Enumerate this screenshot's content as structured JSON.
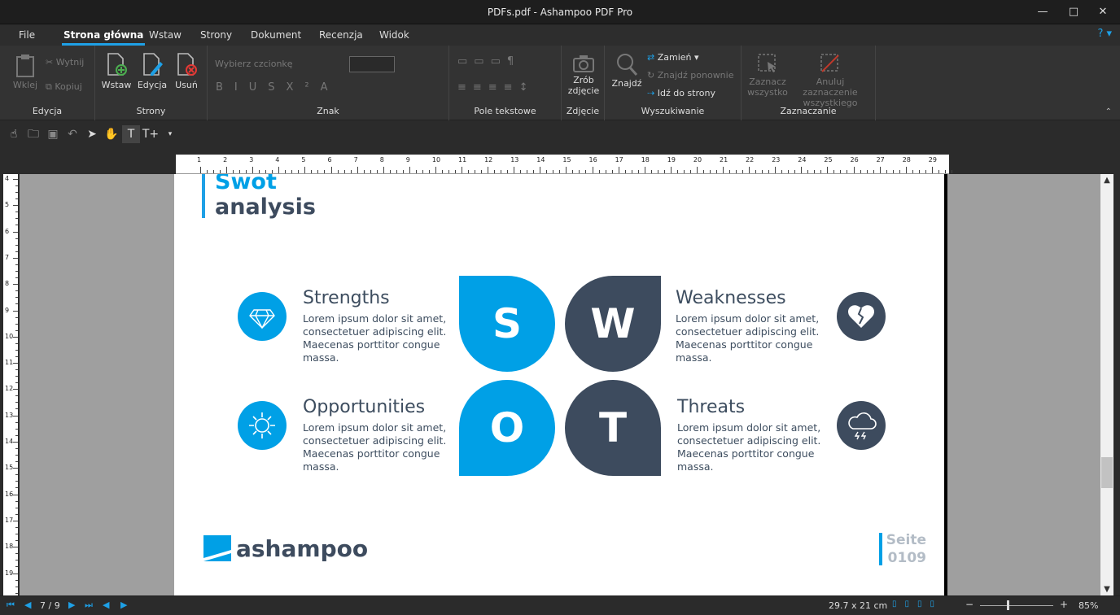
{
  "window": {
    "title": "PDFs.pdf - Ashampoo PDF Pro",
    "minimize": "—",
    "maximize": "□",
    "close": "✕"
  },
  "menu": [
    "File",
    "Strona główna",
    "Wstaw",
    "Strony",
    "Dokument",
    "Recenzja",
    "Widok"
  ],
  "help": "? ▾",
  "ribbon": {
    "edycja": {
      "label": "Edycja",
      "wklej": "Wklej",
      "wytnij": "Wytnij",
      "kopiuj": "Kopiuj"
    },
    "strony": {
      "label": "Strony",
      "wstaw": "Wstaw",
      "edycja": "Edycja",
      "usun": "Usuń"
    },
    "znak": {
      "label": "Znak",
      "font_placeholder": "Wybierz czcionkę"
    },
    "pole": {
      "label": "Pole tekstowe"
    },
    "zdjecie": {
      "label": "Zdjęcie",
      "btn1": "Zrób",
      "btn2": "zdjęcie"
    },
    "wyszukiwanie": {
      "label": "Wyszukiwanie",
      "znajdz": "Znajdź",
      "zamien": "Zamień",
      "znajdz_ponownie": "Znajdź ponownie",
      "idz": "Idź do strony"
    },
    "zaznaczanie": {
      "label": "Zaznaczanie",
      "zaz1": "Zaznacz",
      "zaz2": "wszystko",
      "anul1": "Anuluj zaznaczenie",
      "anul2": "wszystkiego"
    }
  },
  "ruler": {
    "h": [
      "1",
      "2",
      "3",
      "4",
      "5",
      "6",
      "7",
      "8",
      "9",
      "10",
      "11",
      "12",
      "13",
      "14",
      "15",
      "16",
      "17",
      "18",
      "19",
      "20",
      "21",
      "22",
      "23",
      "24",
      "25",
      "26",
      "27",
      "28",
      "29"
    ],
    "v": [
      "4",
      "5",
      "6",
      "7",
      "8",
      "9",
      "10",
      "11",
      "12",
      "13",
      "14",
      "15",
      "16",
      "17",
      "18",
      "19"
    ]
  },
  "doc": {
    "title1": "Swot",
    "title2": "analysis",
    "strengths": {
      "title": "Strengths",
      "text": "Lorem ipsum dolor sit amet, consectetuer adipiscing elit. Maecenas porttitor congue massa."
    },
    "weaknesses": {
      "title": "Weaknesses",
      "text": "Lorem ipsum dolor sit amet, consectetuer adipiscing elit. Maecenas porttitor congue massa."
    },
    "opportunities": {
      "title": "Opportunities",
      "text": "Lorem ipsum dolor sit amet, consectetuer adipiscing elit. Maecenas porttitor congue massa."
    },
    "threats": {
      "title": "Threats",
      "text": "Lorem ipsum dolor sit amet, consectetuer adipiscing elit. Maecenas porttitor congue massa."
    },
    "letters": {
      "s": "S",
      "w": "W",
      "o": "O",
      "t": "T"
    },
    "brand": "ashampoo",
    "seite": "Seite",
    "page_no": "0109",
    "colors": {
      "blue": "#00a0e6",
      "navy": "#3d4b5e"
    }
  },
  "status": {
    "page": "7 / 9",
    "size": "29.7 x 21 cm",
    "zoom": "85%"
  }
}
